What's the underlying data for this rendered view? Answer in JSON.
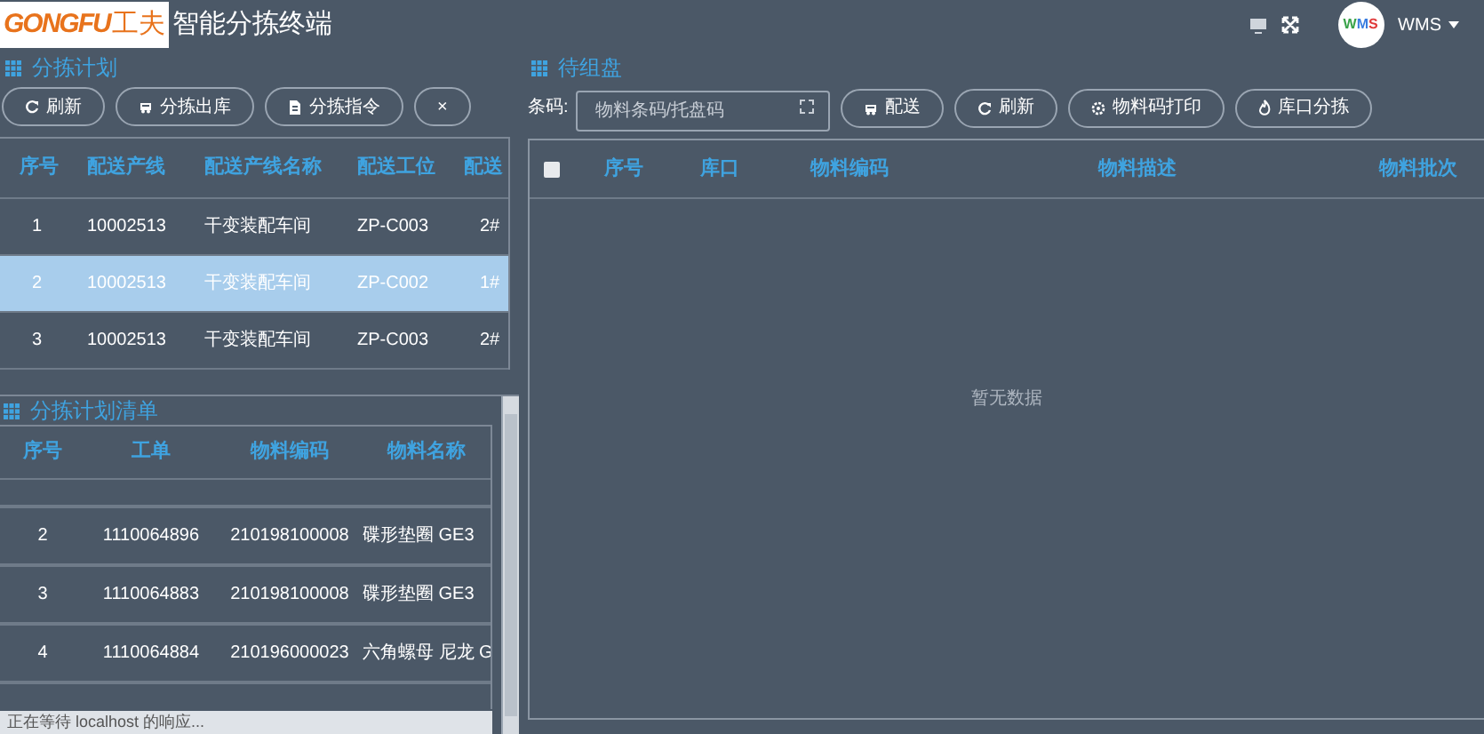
{
  "header": {
    "logo_latin": "GONGFU",
    "logo_cjk": "工夫",
    "title": "智能分拣终端",
    "badge": "WMS",
    "user": "WMS"
  },
  "plan": {
    "title": "分拣计划",
    "buttons": [
      {
        "label": "刷新",
        "kind": "refresh"
      },
      {
        "label": "分拣出库",
        "kind": "truck"
      },
      {
        "label": "分拣指令",
        "kind": "doc"
      },
      {
        "label": "×",
        "kind": "close"
      }
    ],
    "columns": [
      "序号",
      "配送产线",
      "配送产线名称",
      "配送工位",
      "配送"
    ],
    "rows": [
      {
        "cells": [
          "1",
          "10002513",
          "干变装配车间",
          "ZP-C003",
          "2#"
        ],
        "selected": false
      },
      {
        "cells": [
          "2",
          "10002513",
          "干变装配车间",
          "ZP-C002",
          "1#"
        ],
        "selected": true
      },
      {
        "cells": [
          "3",
          "10002513",
          "干变装配车间",
          "ZP-C003",
          "2#"
        ],
        "selected": false
      }
    ]
  },
  "plan_list": {
    "title": "分拣计划清单",
    "columns": [
      "序号",
      "工单",
      "物料编码",
      "物料名称"
    ],
    "rows": [
      {
        "cells": [
          "2",
          "1110064896",
          "210198100008",
          "碟形垫圈 GE3"
        ]
      },
      {
        "cells": [
          "3",
          "1110064883",
          "210198100008",
          "碟形垫圈 GE3"
        ]
      },
      {
        "cells": [
          "4",
          "1110064884",
          "210196000023",
          "六角螺母 尼龙 G"
        ]
      }
    ]
  },
  "pending": {
    "title": "待组盘",
    "barcode_label": "条码:",
    "placeholder": "物料条码/托盘码",
    "buttons": [
      {
        "label": "配送",
        "kind": "truck"
      },
      {
        "label": "刷新",
        "kind": "refresh"
      },
      {
        "label": "物料码打印",
        "kind": "gear"
      },
      {
        "label": "库口分拣",
        "kind": "fire"
      }
    ],
    "select_all_checked": false,
    "columns": [
      "序号",
      "库口",
      "物料编码",
      "物料描述",
      "物料批次"
    ],
    "empty_text": "暂无数据"
  },
  "status_bar": {
    "text": "正在等待 localhost 的响应..."
  }
}
